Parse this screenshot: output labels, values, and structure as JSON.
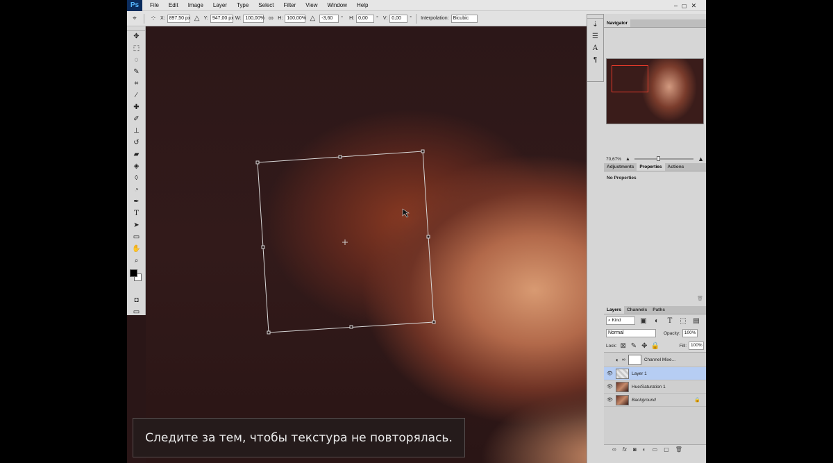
{
  "app": {
    "logo": "Ps"
  },
  "menu": [
    "File",
    "Edit",
    "Image",
    "Layer",
    "Type",
    "Select",
    "Filter",
    "View",
    "Window",
    "Help"
  ],
  "options": {
    "x_label": "X:",
    "x_value": "897,50 px",
    "y_label": "Y:",
    "y_value": "947,00 px",
    "w_label": "W:",
    "w_value": "100,00%",
    "h_label": "H:",
    "h_value": "100,00%",
    "angle_value": "-3,60",
    "hskew_label": "H:",
    "hskew_value": "0,00",
    "vskew_label": "V:",
    "vskew_value": "0,00",
    "interp_label": "Interpolation:",
    "interp_value": "Bicubic"
  },
  "navigator": {
    "tab": "Navigator",
    "zoom": "70,67%"
  },
  "properties": {
    "tabs": [
      "Adjustments",
      "Properties",
      "Actions"
    ],
    "active": "Properties",
    "content": "No Properties"
  },
  "layers_panel": {
    "tabs": [
      "Layers",
      "Channels",
      "Paths"
    ],
    "active": "Layers",
    "kind": "Kind",
    "blend_mode": "Normal",
    "opacity_label": "Opacity:",
    "opacity_value": "100%",
    "lock_label": "Lock:",
    "fill_label": "Fill:",
    "fill_value": "100%",
    "layers": [
      {
        "name": "Channel Mixe...",
        "visible": false,
        "selected": false
      },
      {
        "name": "Layer 1",
        "visible": true,
        "selected": true
      },
      {
        "name": "Hue/Saturation 1",
        "visible": true,
        "selected": false
      },
      {
        "name": "Background",
        "visible": true,
        "selected": false
      }
    ]
  },
  "subtitle": "Следите за тем, чтобы текстура не повторялась.",
  "icons": [
    "move-icon",
    "marquee-icon",
    "lasso-icon",
    "quick-select-icon",
    "crop-icon",
    "eyedropper-icon",
    "healing-icon",
    "brush-icon",
    "stamp-icon",
    "history-brush-icon",
    "eraser-icon",
    "bucket-icon",
    "blur-icon",
    "dodge-icon",
    "pen-icon",
    "type-icon",
    "path-select-icon",
    "shape-icon",
    "hand-icon",
    "zoom-icon",
    "cancel-icon",
    "commit-icon"
  ],
  "colors": {
    "accent": "#b6cdf3",
    "ui_bg": "#d6d6d6"
  }
}
